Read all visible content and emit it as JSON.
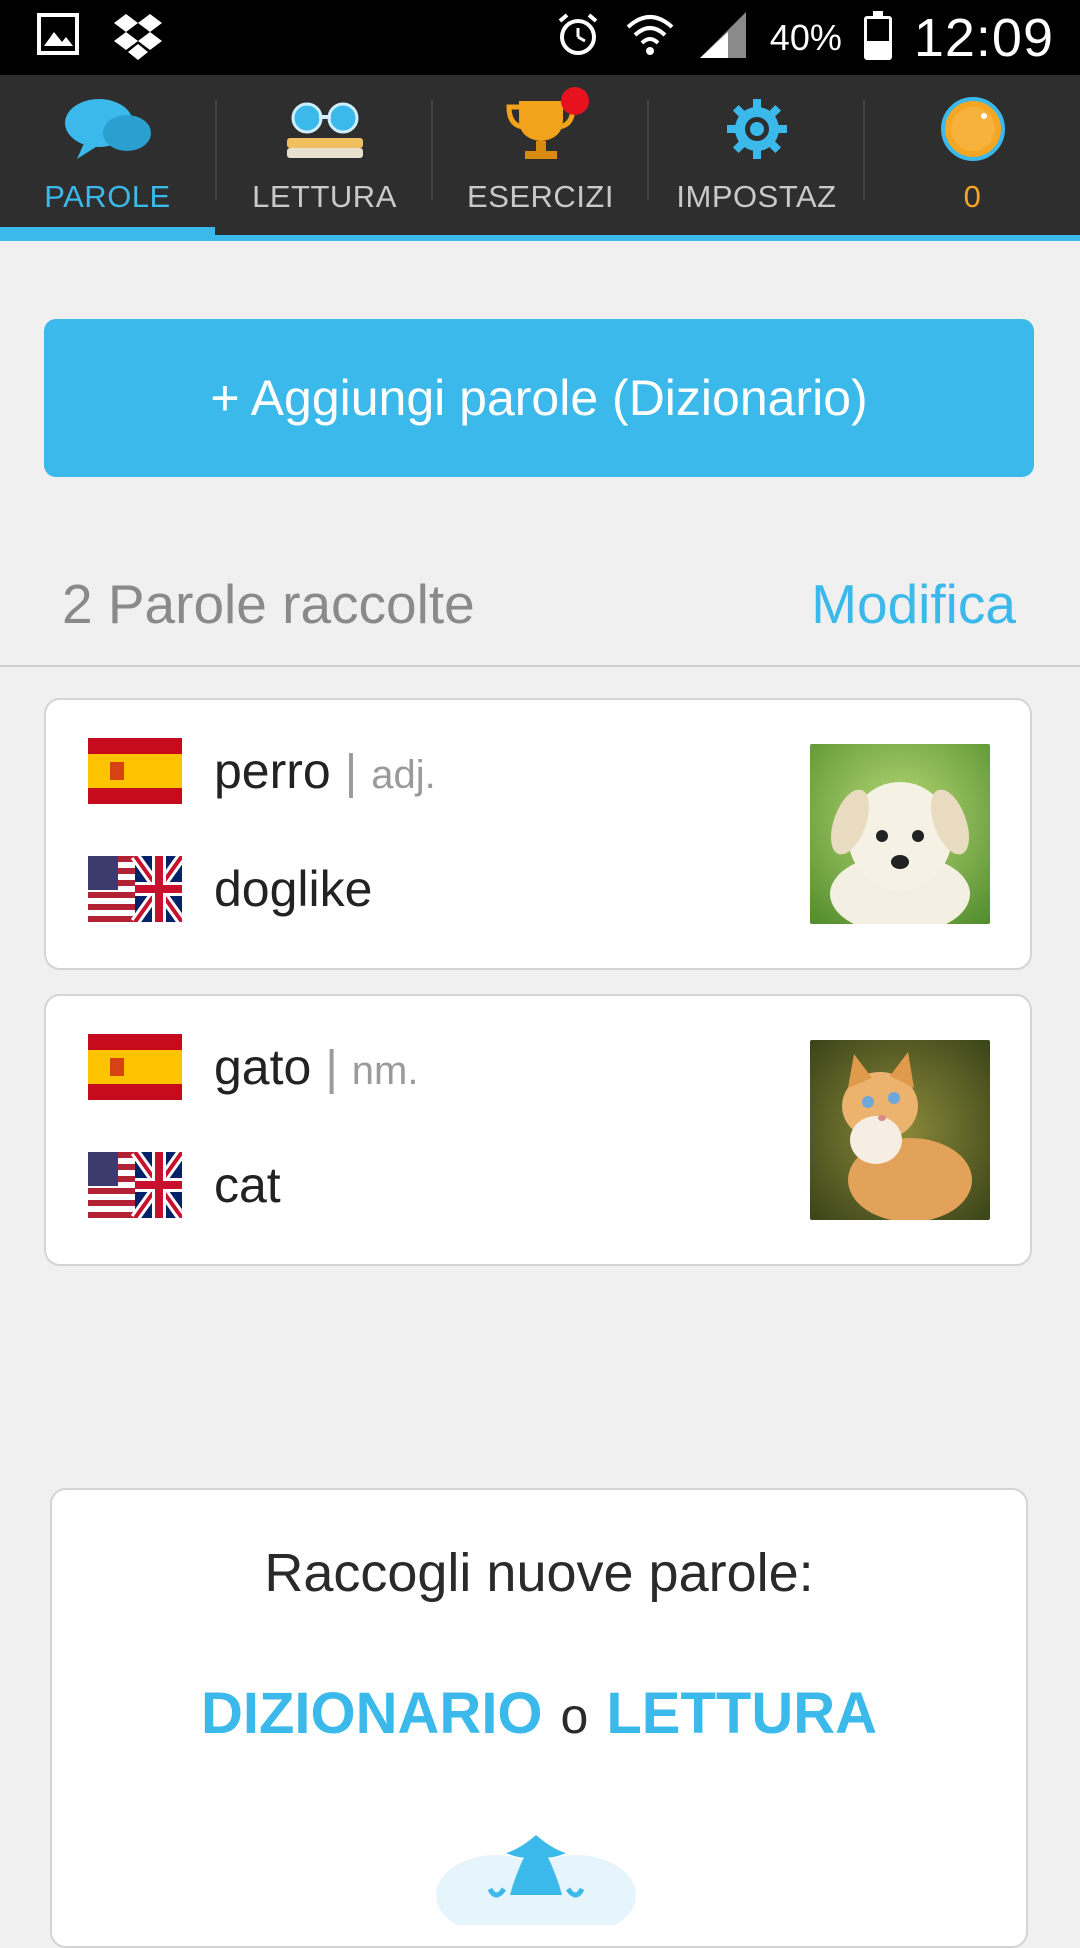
{
  "status_bar": {
    "battery_percent": "40%",
    "battery_level": 0.4,
    "time": "12:09",
    "icons": [
      "gallery-icon",
      "dropbox-icon",
      "alarm-icon",
      "wifi-icon",
      "signal-icon",
      "battery-icon"
    ]
  },
  "tabs": [
    {
      "label": "PAROLE",
      "icon": "speech-bubbles-icon",
      "active": true
    },
    {
      "label": "LETTURA",
      "icon": "glasses-book-icon",
      "active": false
    },
    {
      "label": "ESERCIZI",
      "icon": "trophy-icon",
      "active": false,
      "notification": true
    },
    {
      "label": "IMPOSTAZ",
      "icon": "gear-icon",
      "active": false
    },
    {
      "label": "0",
      "icon": "coin-icon",
      "active": false
    }
  ],
  "add_button": {
    "label": "+ Aggiungi parole (Dizionario)"
  },
  "words_header": {
    "count_label": "2 Parole raccolte",
    "edit_label": "Modifica"
  },
  "words": [
    {
      "word": "perro",
      "pos": "adj.",
      "translation": "doglike",
      "source_flag": "spain-flag-icon",
      "target_flag": "us-uk-flag-icon",
      "image": "puppy-image"
    },
    {
      "word": "gato",
      "pos": "nm.",
      "translation": "cat",
      "source_flag": "spain-flag-icon",
      "target_flag": "us-uk-flag-icon",
      "image": "kitten-image"
    }
  ],
  "collect": {
    "title": "Raccogli nuove parole:",
    "link_dictionary": "DIZIONARIO",
    "or": "o",
    "link_reading": "LETTURA"
  },
  "colors": {
    "accent": "#3ab9ea",
    "tabbar": "#2e2e2e",
    "background": "#f0f0f0",
    "coin": "#f5a623",
    "notification": "#e8121f"
  }
}
